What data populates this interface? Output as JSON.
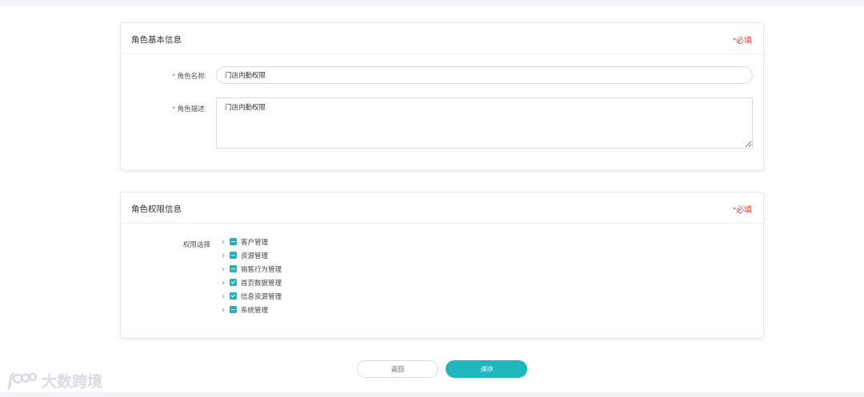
{
  "basic_card": {
    "title": "角色基本信息",
    "required_note": "*必填",
    "name_field": {
      "star": "*",
      "label": "角色名称:",
      "value": "门店内勤权限"
    },
    "desc_field": {
      "star": "*",
      "label": "角色描述:",
      "value": "门店内勤权限"
    }
  },
  "perm_card": {
    "title": "角色权限信息",
    "required_note": "*必填",
    "tree_label": "权限选择",
    "items": [
      {
        "label": "客户管理",
        "state": "partial"
      },
      {
        "label": "资源管理",
        "state": "partial"
      },
      {
        "label": "销售行为管理",
        "state": "partial"
      },
      {
        "label": "首页数据管理",
        "state": "checked"
      },
      {
        "label": "信息资源管理",
        "state": "checked"
      },
      {
        "label": "系统管理",
        "state": "partial"
      }
    ]
  },
  "actions": {
    "back_label": "返回",
    "save_label": "保存"
  },
  "watermark": {
    "text": "大数跨境"
  },
  "colors": {
    "accent": "#1fb6bd",
    "required": "#e0463a"
  }
}
